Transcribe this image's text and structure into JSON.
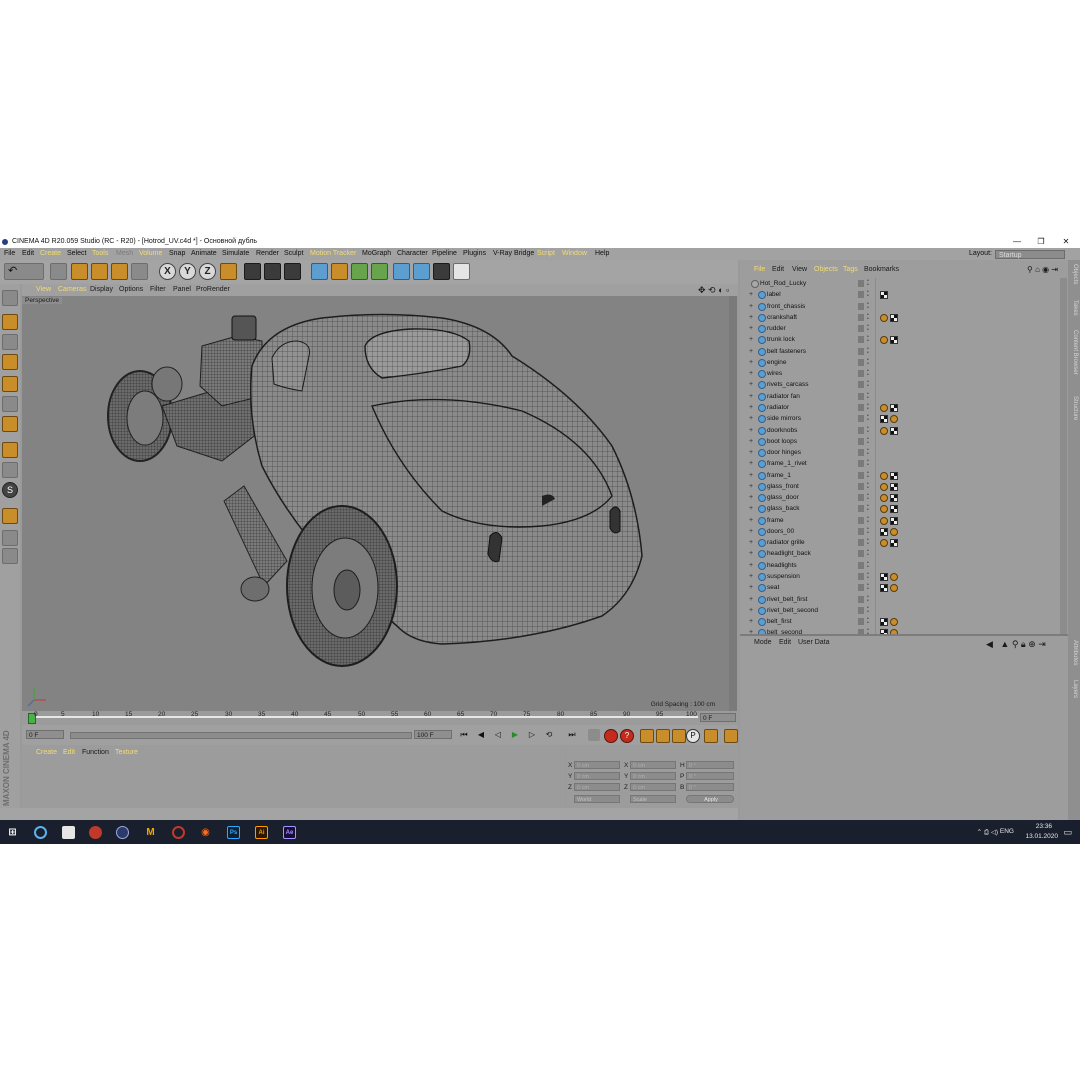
{
  "window": {
    "title": "CINEMA 4D R20.059 Studio (RC - R20) - [Hotrod_UV.c4d *] - Основной дубль",
    "controls": [
      "—",
      "❐",
      "✕"
    ]
  },
  "menu": {
    "items": [
      "File",
      "Edit",
      "Create",
      "Select",
      "Tools",
      "Mesh",
      "Volume",
      "Snap",
      "Animate",
      "Simulate",
      "Render",
      "Sculpt",
      "Motion Tracker",
      "MoGraph",
      "Character",
      "Pipeline",
      "Plugins",
      "V-Ray Bridge",
      "Script",
      "Window",
      "Help"
    ],
    "layout_label": "Layout:",
    "layout_value": "Startup"
  },
  "viewport": {
    "menu": [
      "View",
      "Cameras",
      "Display",
      "Options",
      "Filter",
      "Panel",
      "ProRender"
    ],
    "label": "Perspective",
    "grid_spacing": "Grid Spacing : 100 cm"
  },
  "timeline": {
    "ticks": [
      "0",
      "5",
      "10",
      "15",
      "20",
      "25",
      "30",
      "35",
      "40",
      "45",
      "50",
      "55",
      "60",
      "65",
      "70",
      "75",
      "80",
      "85",
      "90",
      "95",
      "100"
    ],
    "current_frame": "0 F",
    "start_frame": "0 F",
    "end_frame": "100 F"
  },
  "material_panel": {
    "menu": [
      "Create",
      "Edit",
      "Function",
      "Texture"
    ]
  },
  "coordinates": {
    "labels": [
      "X",
      "Y",
      "Z",
      "X",
      "Y",
      "Z",
      "H",
      "P",
      "B"
    ],
    "values": [
      "0 cm",
      "0 cm",
      "0 cm",
      "0 cm",
      "0 cm",
      "0 cm",
      "0 °",
      "0 °",
      "0 °"
    ],
    "world": "World",
    "scale": "Scale",
    "apply": "Apply"
  },
  "objects_panel": {
    "menu": [
      "File",
      "Edit",
      "View",
      "Objects",
      "Tags",
      "Bookmarks"
    ],
    "items": [
      {
        "name": "Hot_Rod_Lucky",
        "tags": ""
      },
      {
        "name": "label",
        "tags": "m"
      },
      {
        "name": "front_chassis",
        "tags": ""
      },
      {
        "name": "crankshaft",
        "tags": "um"
      },
      {
        "name": "rudder",
        "tags": ""
      },
      {
        "name": "trunk lock",
        "tags": "um"
      },
      {
        "name": "belt fasteners",
        "tags": ""
      },
      {
        "name": "engine",
        "tags": ""
      },
      {
        "name": "wires",
        "tags": ""
      },
      {
        "name": "rivets_carcass",
        "tags": ""
      },
      {
        "name": "radiator fan",
        "tags": ""
      },
      {
        "name": "radiator",
        "tags": "um"
      },
      {
        "name": "side mirrors",
        "tags": "mu"
      },
      {
        "name": "doorknobs",
        "tags": "um"
      },
      {
        "name": "boot loops",
        "tags": ""
      },
      {
        "name": "door hinges",
        "tags": ""
      },
      {
        "name": "frame_1_rivet",
        "tags": ""
      },
      {
        "name": "frame_1",
        "tags": "um"
      },
      {
        "name": "glass_front",
        "tags": "um"
      },
      {
        "name": "glass_door",
        "tags": "um"
      },
      {
        "name": "glass_back",
        "tags": "um"
      },
      {
        "name": "frame",
        "tags": "um"
      },
      {
        "name": "doors_00",
        "tags": "mu"
      },
      {
        "name": "radiator grille",
        "tags": "um"
      },
      {
        "name": "headlight_back",
        "tags": ""
      },
      {
        "name": "headlights",
        "tags": ""
      },
      {
        "name": "suspension",
        "tags": "mu"
      },
      {
        "name": "seat",
        "tags": "mu"
      },
      {
        "name": "rivet_belt_first",
        "tags": ""
      },
      {
        "name": "rivet_belt_second",
        "tags": ""
      },
      {
        "name": "belt_first",
        "tags": "mu"
      },
      {
        "name": "belt_second",
        "tags": "mu"
      }
    ]
  },
  "attributes_panel": {
    "menu": [
      "Mode",
      "Edit",
      "User Data"
    ]
  },
  "right_tabs": [
    "Objects",
    "Takes",
    "Content Browser",
    "Structure"
  ],
  "right_tabs_lower": [
    "Attributes",
    "Layers"
  ],
  "maxon": "MAXON CINEMA 4D",
  "taskbar": {
    "lang": "ENG",
    "time": "23:36",
    "date": "13.01.2020"
  }
}
